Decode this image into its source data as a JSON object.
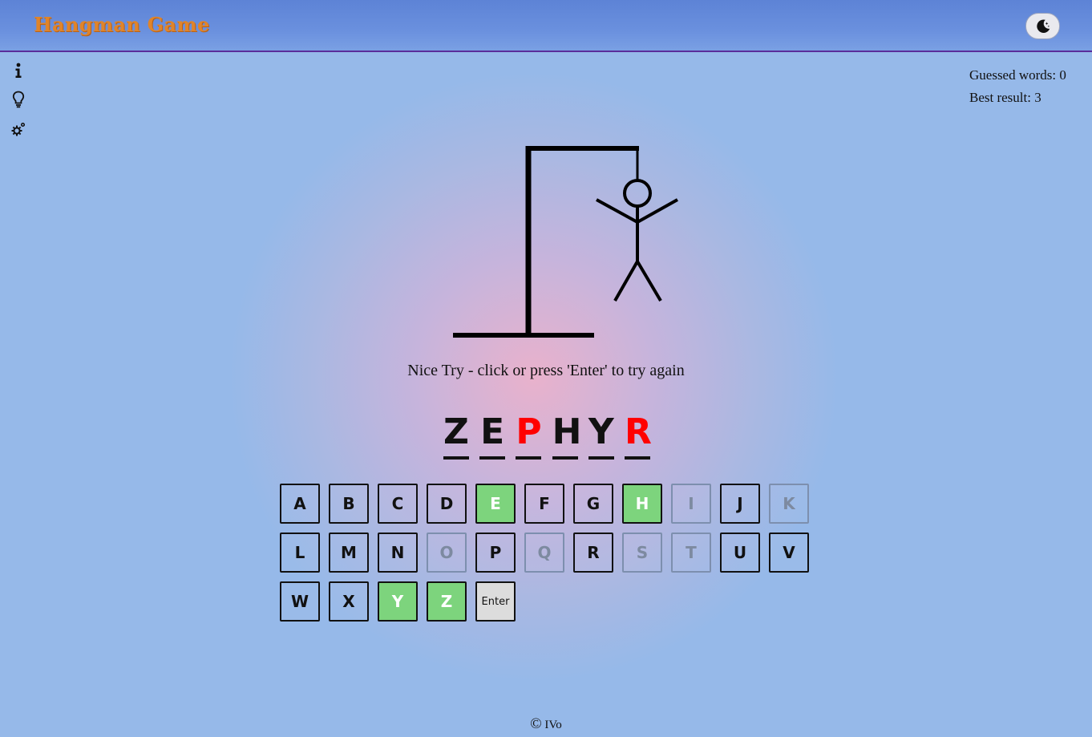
{
  "header": {
    "title": "Hangman Game",
    "theme_toggle_icon": "moon-icon"
  },
  "sidebar": {
    "icons": [
      "info-icon",
      "lightbulb-icon",
      "settings-icon"
    ]
  },
  "stats": {
    "guessed_words": "Guessed words: 0",
    "best_result": "Best result: 3"
  },
  "message": "Nice Try - click or press 'Enter' to try again",
  "word": [
    {
      "letter": "Z",
      "color": "#111111"
    },
    {
      "letter": "E",
      "color": "#111111"
    },
    {
      "letter": "P",
      "color": "#ff0000"
    },
    {
      "letter": "H",
      "color": "#111111"
    },
    {
      "letter": "Y",
      "color": "#111111"
    },
    {
      "letter": "R",
      "color": "#ff0000"
    }
  ],
  "keyboard": {
    "rows": [
      [
        {
          "label": "A",
          "state": "normal"
        },
        {
          "label": "B",
          "state": "normal"
        },
        {
          "label": "C",
          "state": "normal"
        },
        {
          "label": "D",
          "state": "normal"
        },
        {
          "label": "E",
          "state": "correct"
        },
        {
          "label": "F",
          "state": "normal"
        },
        {
          "label": "G",
          "state": "normal"
        },
        {
          "label": "H",
          "state": "correct"
        },
        {
          "label": "I",
          "state": "disabled"
        },
        {
          "label": "J",
          "state": "normal"
        },
        {
          "label": "K",
          "state": "disabled"
        }
      ],
      [
        {
          "label": "L",
          "state": "normal"
        },
        {
          "label": "M",
          "state": "normal"
        },
        {
          "label": "N",
          "state": "normal"
        },
        {
          "label": "O",
          "state": "disabled"
        },
        {
          "label": "P",
          "state": "normal"
        },
        {
          "label": "Q",
          "state": "disabled"
        },
        {
          "label": "R",
          "state": "normal"
        },
        {
          "label": "S",
          "state": "disabled"
        },
        {
          "label": "T",
          "state": "disabled"
        },
        {
          "label": "U",
          "state": "normal"
        },
        {
          "label": "V",
          "state": "normal"
        }
      ],
      [
        {
          "label": "W",
          "state": "normal"
        },
        {
          "label": "X",
          "state": "normal"
        },
        {
          "label": "Y",
          "state": "correct"
        },
        {
          "label": "Z",
          "state": "correct"
        },
        {
          "label": "Enter",
          "state": "enter"
        }
      ]
    ]
  },
  "footer": {
    "symbol": "©",
    "author": "IVo"
  },
  "colors": {
    "correct_key": "#7dd47d",
    "missed_letter": "#ff0000",
    "header": "#6a90de",
    "title": "#e0842a"
  }
}
